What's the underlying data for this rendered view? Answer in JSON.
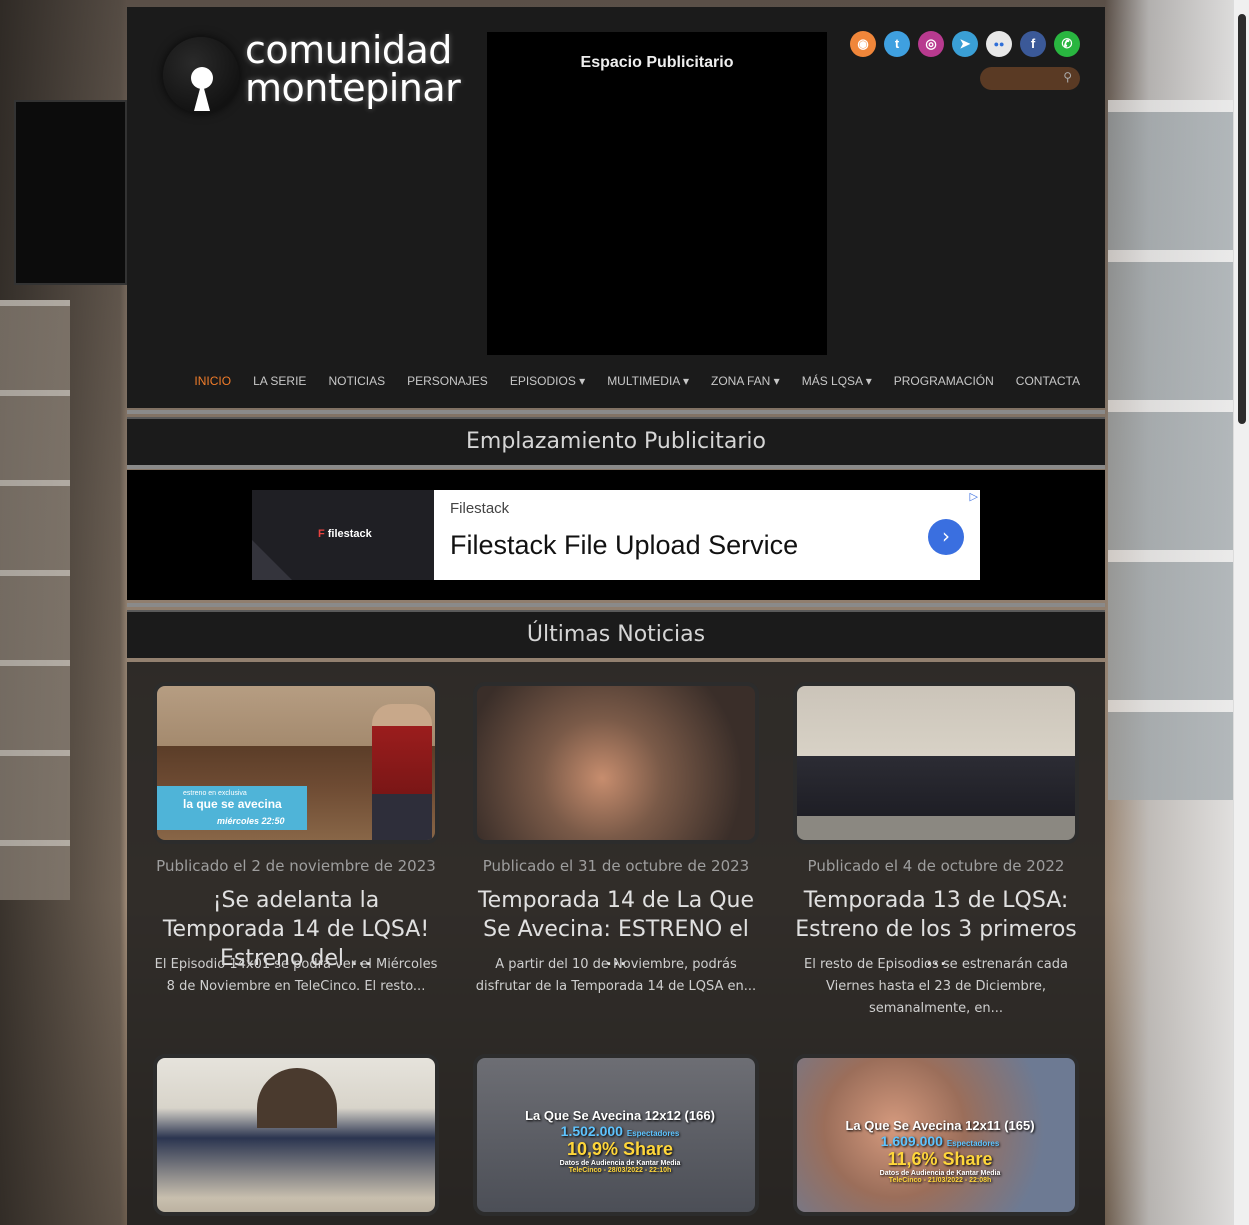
{
  "site": {
    "logo_line1": "comunidad",
    "logo_line2": "montepinar"
  },
  "header_ad": {
    "title": "Espacio Publicitario"
  },
  "social": [
    {
      "name": "rss-icon",
      "glyph": "◉",
      "color": "#f0863a"
    },
    {
      "name": "twitter-icon",
      "glyph": "t",
      "color": "#3fa0e0"
    },
    {
      "name": "instagram-icon",
      "glyph": "◎",
      "color": "#b83a8f"
    },
    {
      "name": "telegram-icon",
      "glyph": "➤",
      "color": "#3a9fd5"
    },
    {
      "name": "flickr-icon",
      "glyph": "●●",
      "color": "#e8e8e8"
    },
    {
      "name": "facebook-icon",
      "glyph": "f",
      "color": "#3b5998"
    },
    {
      "name": "whatsapp-icon",
      "glyph": "✆",
      "color": "#29b640"
    }
  ],
  "search": {
    "placeholder": "",
    "icon": "search-icon"
  },
  "nav": [
    {
      "label": "INICIO",
      "active": true
    },
    {
      "label": "LA SERIE"
    },
    {
      "label": "NOTICIAS"
    },
    {
      "label": "PERSONAJES"
    },
    {
      "label": "EPISODIOS ▾"
    },
    {
      "label": "MULTIMEDIA ▾"
    },
    {
      "label": "ZONA FAN ▾"
    },
    {
      "label": "MÁS LQSA ▾"
    },
    {
      "label": "PROGRAMACIÓN"
    },
    {
      "label": "CONTACTA"
    }
  ],
  "ad_section": {
    "heading": "Emplazamiento Publicitario",
    "banner": {
      "brand": "Filestack",
      "headline": "Filestack File Upload Service",
      "logo_text": "filestack",
      "cta_glyph": "›",
      "adchoices_glyph": "▷"
    }
  },
  "news_section": {
    "heading": "Últimas Noticias",
    "posts": [
      {
        "date": "Publicado el 2 de noviembre de 2023",
        "title": "¡Se adelanta la Temporada 14 de LQSA! Estreno del ...",
        "excerpt": "El Episodio 14x01 se podrá ver el Miércoles 8 de Noviembre en TeleCinco. El resto...",
        "overlay_small": "estreno en exclusiva",
        "overlay_brand": "la que se avecina",
        "overlay_when": "miércoles 22:50"
      },
      {
        "date": "Publicado el 31 de octubre de 2023",
        "title": "Temporada 14 de La Que Se Avecina: ESTRENO el ...",
        "excerpt": "A partir del 10 de Noviembre, podrás disfrutar de la Temporada 14 de LQSA en..."
      },
      {
        "date": "Publicado el 4 de octubre de 2022",
        "title": "Temporada 13 de LQSA: Estreno de los 3 primeros ...",
        "excerpt": "El resto de Episodios se estrenarán cada Viernes hasta el 23 de Diciembre, semanalmente, en..."
      },
      {
        "date": "",
        "title": "",
        "excerpt": ""
      },
      {
        "date": "",
        "title": "",
        "excerpt": "",
        "overlay": {
          "line1": "La Que Se Avecina 12x12 (166)",
          "viewers": "1.502.000",
          "viewers_label": "Espectadores",
          "share": "10,9% Share",
          "source": "Datos de Audiencia de Kantar Media",
          "when": "TeleCinco - 28/03/2022 - 22:10h"
        }
      },
      {
        "date": "",
        "title": "",
        "excerpt": "",
        "overlay": {
          "line1": "La Que Se Avecina 12x11 (165)",
          "viewers": "1.609.000",
          "viewers_label": "Espectadores",
          "share": "11,6% Share",
          "source": "Datos de Audiencia de Kantar Media",
          "when": "TeleCinco - 21/03/2022 - 22:08h"
        }
      }
    ]
  },
  "colors": {
    "accent": "#f07c2a",
    "panel": "#1b1b1b",
    "nav_text": "#c8c8c8"
  }
}
